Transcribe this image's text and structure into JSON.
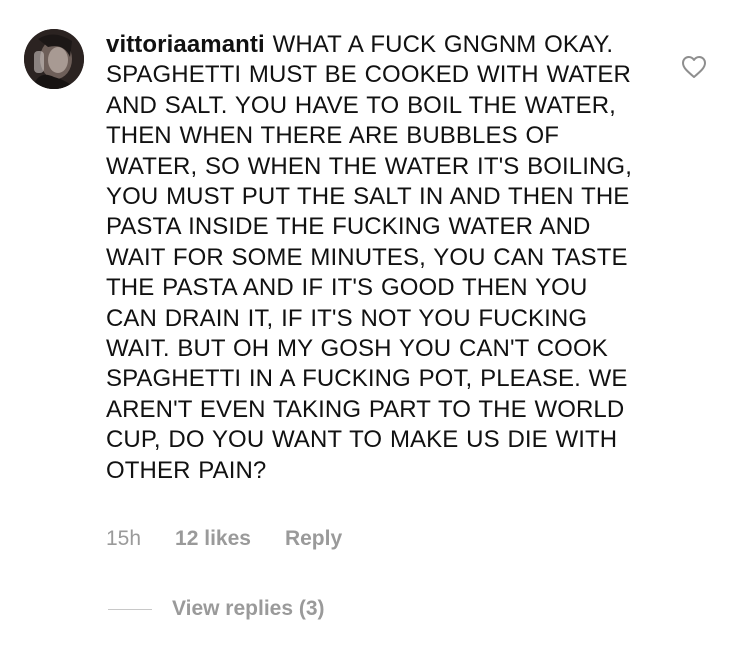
{
  "comment": {
    "username": "vittoriaamanti",
    "text": "WHAT A FUCK GNGNM OKAY. SPAGHETTI MUST BE COOKED WITH WATER AND SALT. YOU HAVE TO BOIL THE WATER, THEN WHEN THERE ARE BUBBLES OF WATER, SO WHEN THE WATER IT'S BOILING, YOU MUST PUT THE SALT IN AND THEN THE PASTA INSIDE THE FUCKING WATER AND WAIT FOR SOME MINUTES, YOU CAN TASTE THE PASTA AND IF IT'S GOOD THEN YOU CAN DRAIN IT, IF IT'S NOT YOU FUCKING WAIT. BUT OH MY GOSH YOU CAN'T COOK SPAGHETTI IN A FUCKING POT, PLEASE. WE AREN'T EVEN TAKING PART TO THE WORLD CUP, DO YOU WANT TO MAKE US DIE WITH OTHER PAIN?",
    "timestamp": "15h",
    "likes": "12 likes",
    "reply_label": "Reply",
    "view_replies_label": "View replies (3)",
    "like_icon": "heart-outline-icon"
  },
  "colors": {
    "text": "#111111",
    "meta": "#9a9a9a",
    "divider": "#c8c8c8"
  }
}
